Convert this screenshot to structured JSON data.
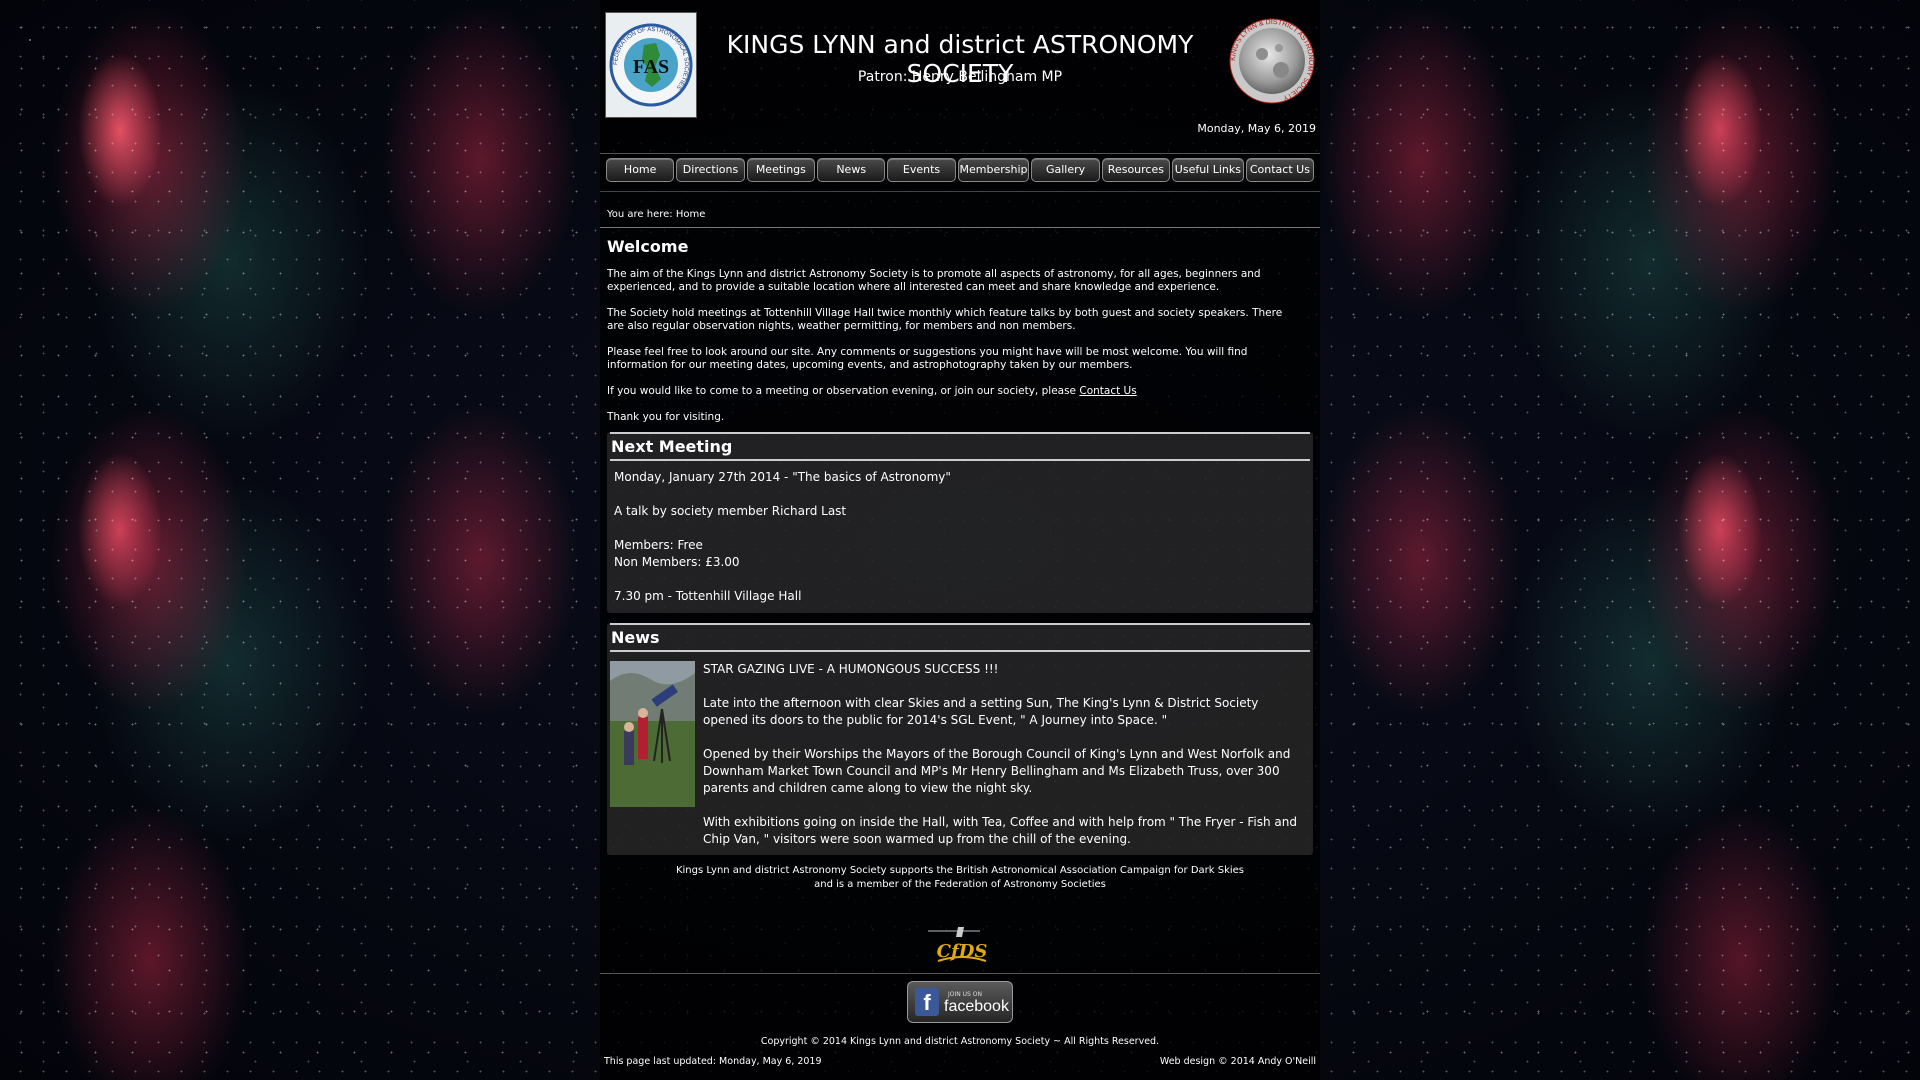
{
  "header": {
    "title": "KINGS LYNN and district ASTRONOMY SOCIETY",
    "patron": "Patron: Henry Bellingham MP",
    "date": "Monday, May 6, 2019",
    "fas_logo_text": "FAS",
    "fas_ring_text": "FEDERATION OF ASTRONOMICAL SOCIETIES",
    "moon_ring_text": "KING'S LYNN & DISTRICT ASTRONOMY SOCIETY"
  },
  "nav": {
    "items": [
      "Home",
      "Directions",
      "Meetings",
      "News",
      "Events",
      "Membership",
      "Gallery",
      "Resources",
      "Useful Links",
      "Contact Us"
    ]
  },
  "breadcrumb": "You are here: Home",
  "welcome": {
    "heading": "Welcome",
    "p1": "The aim of the Kings Lynn and district Astronomy Society is to promote all aspects of astronomy, for all ages, beginners and experienced, and to provide a suitable location where all interested can meet and share knowledge and experience.",
    "p2": "The Society hold meetings at Tottenhill Village Hall twice monthly which feature talks by both guest and society speakers. There are also regular observation nights, weather permitting, for members and non members.",
    "p3": "Please feel free to look around our site. Any comments or suggestions you might have will be most welcome. You will find information for our meeting dates, upcoming events, and astrophotography taken by our members.",
    "p4_prefix": "If you would like to come to a meeting or observation evening, or join our society, please",
    "p4_link": "Contact Us",
    "p5": "Thank you for visiting."
  },
  "next_meeting": {
    "heading": "Next Meeting",
    "date_title": "Monday, January 27th 2014 - \"The basics of Astronomy\"",
    "talk": "A talk by society member Richard Last",
    "members": "Members: Free",
    "non_members": "Non Members: £3.00",
    "time_place": "7.30 pm - Tottenhill Village Hall"
  },
  "news": {
    "heading": "News",
    "headline": "STAR GAZING LIVE - A HUMONGOUS SUCCESS !!!",
    "p1": "Late into the afternoon with clear Skies and a setting Sun, The King's Lynn & District Society opened its doors to the public for 2014's SGL Event, \" A Journey into Space. \"",
    "p2": "Opened by their Worships the Mayors of the Borough Council of King's Lynn and West Norfolk and Downham Market Town Council and MP's Mr Henry Bellingham and Ms Elizabeth Truss, over 300 parents and children came along to view the night sky.",
    "p3": "With exhibitions going on inside the Hall, with Tea, Coffee and with help from \" The Fryer - Fish and Chip Van, \" visitors were soon warmed up from the chill of the evening."
  },
  "footer": {
    "note_line1": "Kings Lynn and district Astronomy Society supports the British Astronomical Association Campaign for Dark Skies",
    "note_line2": "and is a member of the Federation of Astronomy Societies",
    "cfds_logo_text": "CfDS",
    "fb_small": "JOIN US ON",
    "fb_word": "facebook",
    "copyright": "Copyright © 2014 Kings Lynn and district Astronomy Society ~ All Rights Reserved.",
    "last_updated": "This page last updated: Monday, May 6, 2019",
    "web_design": "Web design © 2014 Andy O'Neill"
  },
  "colors": {
    "background": "#05060d",
    "nebula": "#ff5a6e",
    "panel": "#000000",
    "text": "#ffffff",
    "facebook": "#3b5998"
  }
}
